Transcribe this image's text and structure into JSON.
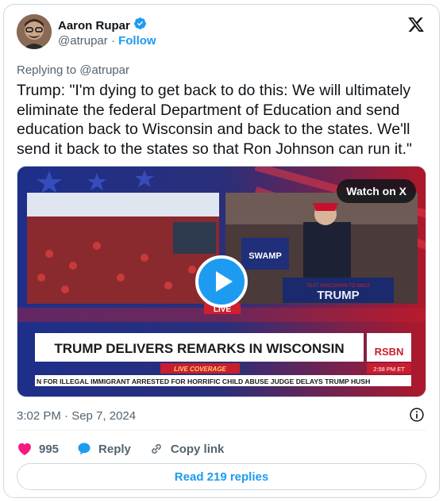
{
  "author": {
    "name": "Aaron Rupar",
    "handle": "@atrupar",
    "separator": "·",
    "follow_label": "Follow"
  },
  "replying_to": "Replying to @atrupar",
  "tweet_text": "Trump: \"I'm dying to get back to do this: We will ultimately eliminate the federal Department of Education and send education back to Wisconsin and back to the states. We'll send it back to the states so that Ron Johnson can run it.\"",
  "media": {
    "watch_label": "Watch on X",
    "live_badge": "LIVE",
    "lower_third_title": "TRUMP DELIVERS REMARKS IN WISCONSIN",
    "live_coverage": "LIVE COVERAGE",
    "network": "RSBN",
    "clock": "2:58 PM ET",
    "ticker": "N FOR ILLEGAL IMMIGRANT ARRESTED FOR HORRIFIC CHILD ABUSE    JUDGE DELAYS TRUMP HUSH",
    "sign_left": "SWAMP",
    "podium_text_small": "TEXT WISCONSIN TO 88022",
    "podium_text": "TRUMP"
  },
  "timestamp": "3:02 PM · Sep 7, 2024",
  "actions": {
    "likes": "995",
    "reply_label": "Reply",
    "copy_label": "Copy link"
  },
  "read_replies": "Read 219 replies",
  "colors": {
    "accent": "#1d9bf0",
    "like": "#f91880",
    "text": "#0f1419",
    "secondary": "#536471"
  }
}
